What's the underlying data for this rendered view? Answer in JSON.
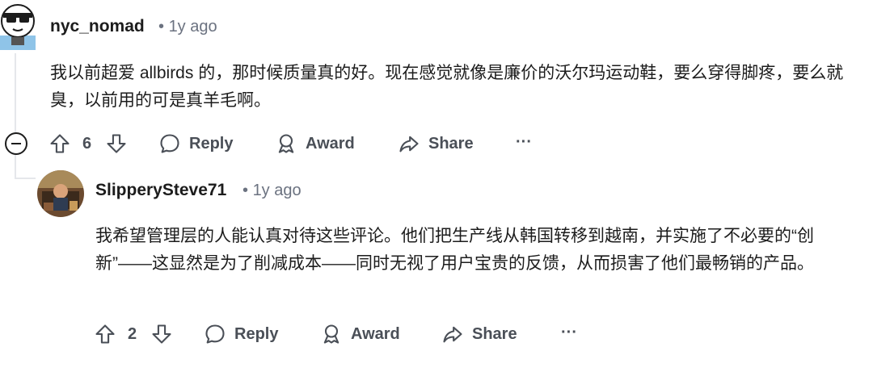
{
  "comments": [
    {
      "username": "nyc_nomad",
      "time": "1y ago",
      "body": "我以前超爱 allbirds 的，那时候质量真的好。现在感觉就像是廉价的沃尔玛运动鞋，要么穿得脚疼，要么就臭，以前用的可是真羊毛啊。",
      "votes": "6",
      "reply": "Reply",
      "award": "Award",
      "share": "Share",
      "more": "···"
    },
    {
      "username": "SlipperySteve71",
      "time": "1y ago",
      "body": "我希望管理层的人能认真对待这些评论。他们把生产线从韩国转移到越南，并实施了不必要的“创新”——这显然是为了削减成本——同时无视了用户宝贵的反馈，从而损害了他们最畅销的产品。",
      "votes": "2",
      "reply": "Reply",
      "award": "Award",
      "share": "Share",
      "more": "···"
    }
  ]
}
